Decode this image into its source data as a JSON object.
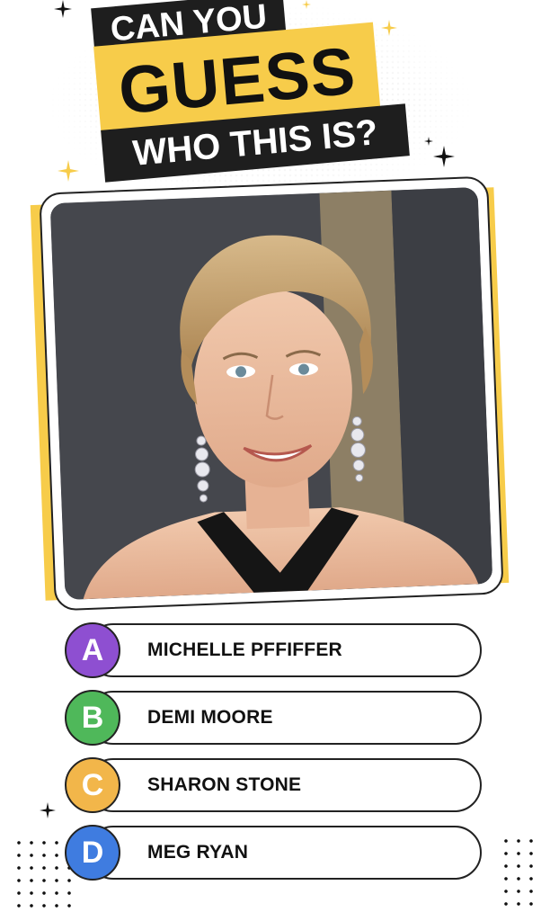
{
  "title": {
    "line1": "CAN YOU",
    "line2": "GUESS",
    "line3": "WHO THIS IS?"
  },
  "colors": {
    "accent_yellow": "#f7cc4a",
    "banner_black": "#1e1e1e",
    "badge_a": "#8e4fd1",
    "badge_b": "#4fb85a",
    "badge_c": "#f2b64a",
    "badge_d": "#3f7ce0"
  },
  "photo": {
    "subject": "portrait of a woman with short blonde hair and diamond drop earrings"
  },
  "answers": [
    {
      "letter": "A",
      "text": "MICHELLE PFFIFFER"
    },
    {
      "letter": "B",
      "text": "DEMI MOORE"
    },
    {
      "letter": "C",
      "text": "SHARON STONE"
    },
    {
      "letter": "D",
      "text": "MEG RYAN"
    }
  ],
  "icons": {
    "sparkle": "sparkle-icon"
  }
}
